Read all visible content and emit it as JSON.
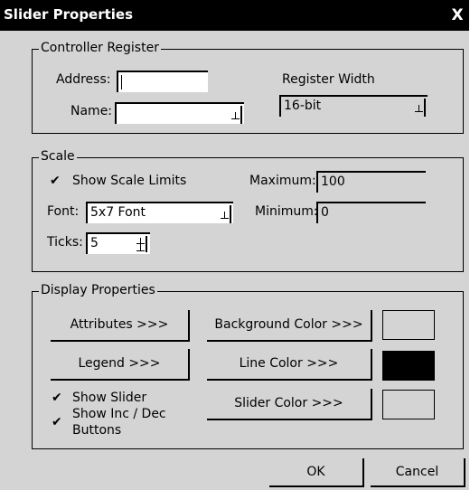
{
  "window": {
    "title": "Slider Properties",
    "close_glyph": "X"
  },
  "controller_register": {
    "legend": "Controller Register",
    "address_label": "Address:",
    "address_value": "",
    "name_label": "Name:",
    "name_value": "",
    "register_width_label": "Register Width",
    "register_width_value": "16-bit"
  },
  "scale": {
    "legend": "Scale",
    "show_scale_limits_label": "Show Scale Limits",
    "show_scale_limits_checked": true,
    "font_label": "Font:",
    "font_value": "5x7 Font",
    "ticks_label": "Ticks:",
    "ticks_value": "5",
    "maximum_label": "Maximum:",
    "maximum_value": "100",
    "minimum_label": "Minimum:",
    "minimum_value": "0"
  },
  "display_properties": {
    "legend": "Display Properties",
    "attributes_button": "Attributes >>>",
    "legend_button": "Legend >>>",
    "background_color_button": "Background Color >>>",
    "line_color_button": "Line Color >>>",
    "slider_color_button": "Slider Color >>>",
    "show_slider_label": "Show Slider",
    "show_slider_checked": true,
    "show_inc_dec_label_line1": "Show Inc / Dec",
    "show_inc_dec_label_line2": "Buttons",
    "show_inc_dec_checked": true,
    "background_color": "#d4d4d4",
    "line_color": "#000000",
    "slider_color": "#d4d4d4"
  },
  "buttons": {
    "ok": "OK",
    "cancel": "Cancel"
  },
  "check_glyph": "✔"
}
